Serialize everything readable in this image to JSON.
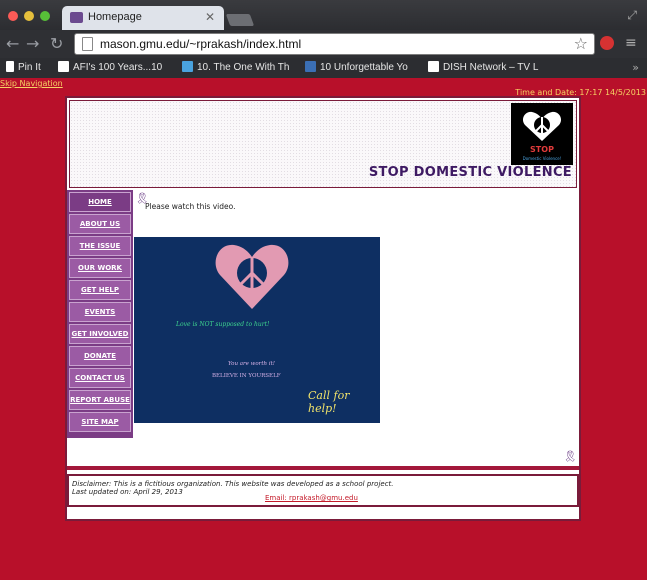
{
  "browser": {
    "tab_title": "Homepage",
    "url": "mason.gmu.edu/~rprakash/index.html",
    "bookmarks": [
      {
        "label": "Pin It",
        "icon": "page-icon",
        "color": "#ffffff"
      },
      {
        "label": "AFI's 100 Years...10",
        "icon": "w-icon",
        "color": "#ffffff"
      },
      {
        "label": "10. The One With Th",
        "icon": "bird-icon",
        "color": "#4aa3df"
      },
      {
        "label": "10 Unforgettable Yo",
        "icon": "m-icon",
        "color": "#3b6fb5"
      },
      {
        "label": "DISH Network – TV L",
        "icon": "zap2it-icon",
        "color": "#ffffff"
      }
    ]
  },
  "page": {
    "skip_link": "Skip Navigation",
    "datetime": "Time and Date: 17:17 14/5/2013",
    "header_title": "STOP DOMESTIC VIOLENCE",
    "logo_text": "STOP",
    "logo_subtext": "Domestic Violence!",
    "nav": [
      "HOME",
      "ABOUT US",
      "THE ISSUE",
      "OUR WORK",
      "GET HELP",
      "EVENTS",
      "GET INVOLVED",
      "DONATE",
      "CONTACT US",
      "REPORT ABUSE",
      "SITE MAP"
    ],
    "intro": "Please watch this video.",
    "video": {
      "love_text": "Love is NOT supposed to hurt!",
      "worth_text": "You are worth it!",
      "believe_text": "BELIEVE IN YOURSELF",
      "call_text": "Call for help!"
    },
    "footer": {
      "disclaimer": "Disclaimer: This is a fictitious organization. This website was developed as a school project.",
      "updated": "Last updated on: April 29, 2013",
      "email": "Email: rprakash@gmu.edu"
    }
  },
  "colors": {
    "background": "#b8102a",
    "nav_button": "#9b5ba4",
    "title": "#3e1a63",
    "accent_yellow": "#f6d264"
  }
}
